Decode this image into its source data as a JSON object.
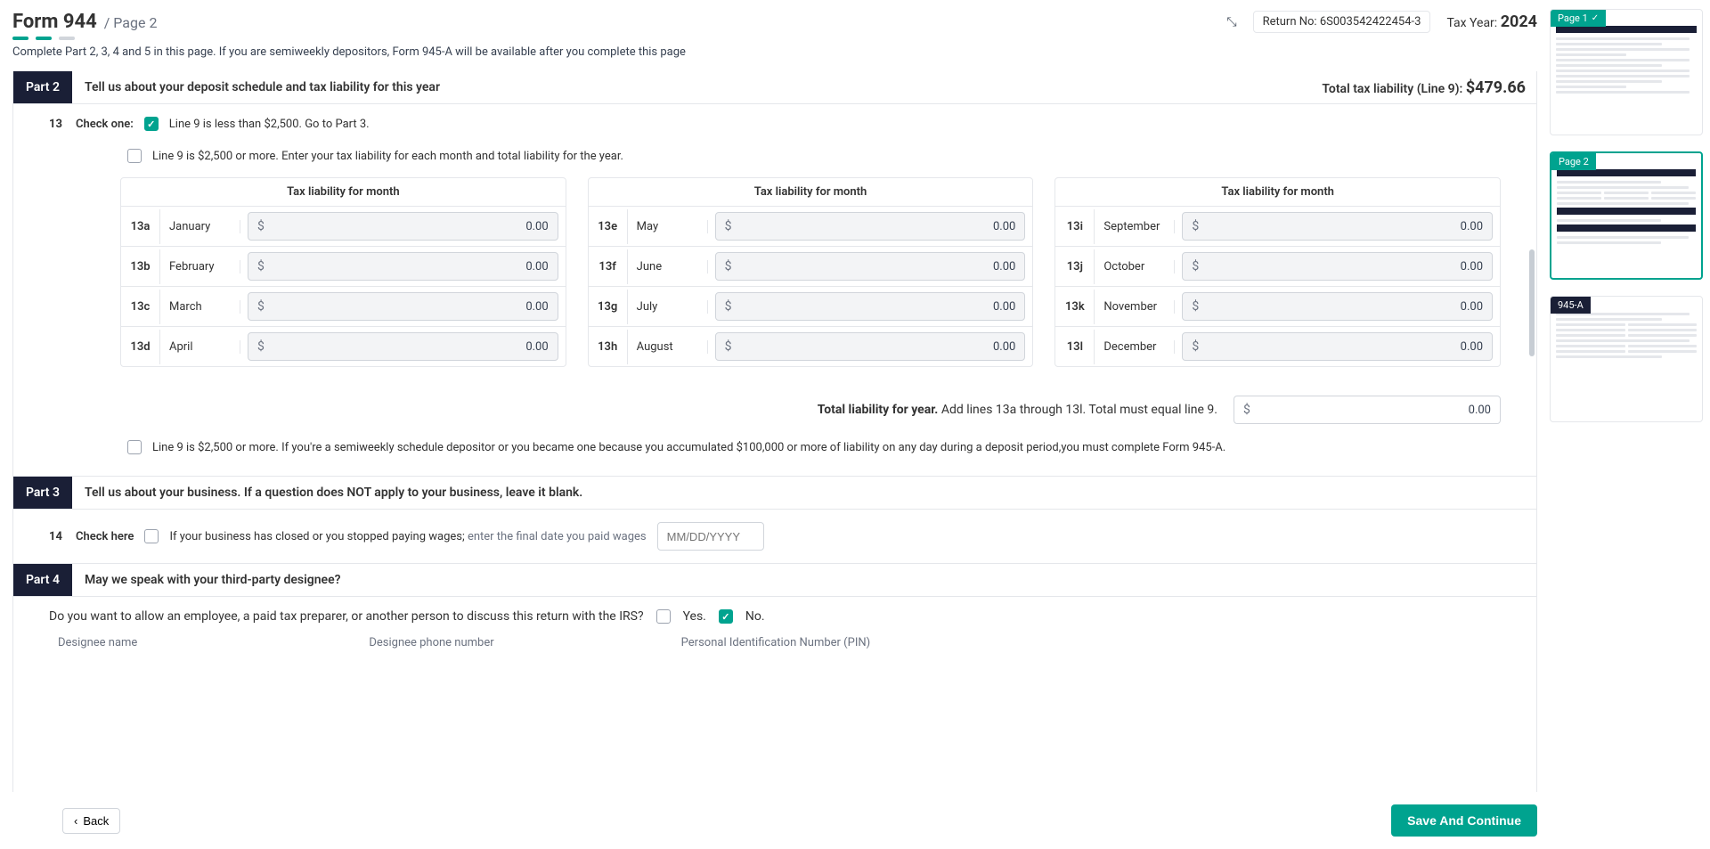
{
  "header": {
    "title": "Form 944",
    "page_label": "/ Page 2",
    "collapse_glyph": "⤡",
    "return_no_label": "Return No:",
    "return_no": "6S003542422454-3",
    "tax_year_label": "Tax Year:",
    "tax_year": "2024"
  },
  "subtitle": "Complete Part 2, 3, 4 and 5 in this page. If you are semiweekly depositors, Form 945-A will be available after you complete this page",
  "part2": {
    "tag": "Part 2",
    "desc": "Tell us about your deposit schedule and tax liability for this year",
    "total_label": "Total tax liability (Line 9):",
    "total_amount": "$479.66",
    "line13_num": "13",
    "line13_label": "Check one:",
    "opt1": "Line 9 is less than $2,500. Go to Part 3.",
    "opt2": "Line 9 is $2,500 or more. Enter your tax liability for each month and total liability for the year.",
    "opt3": "Line 9 is $2,500 or more. If you're a semiweekly schedule depositor or you became one because you accumulated $100,000 or more of liability on any day during a deposit period,you must complete Form 945-A.",
    "col_header": "Tax liability for month",
    "months": {
      "col1": [
        {
          "code": "13a",
          "name": "January",
          "value": "0.00"
        },
        {
          "code": "13b",
          "name": "February",
          "value": "0.00"
        },
        {
          "code": "13c",
          "name": "March",
          "value": "0.00"
        },
        {
          "code": "13d",
          "name": "April",
          "value": "0.00"
        }
      ],
      "col2": [
        {
          "code": "13e",
          "name": "May",
          "value": "0.00"
        },
        {
          "code": "13f",
          "name": "June",
          "value": "0.00"
        },
        {
          "code": "13g",
          "name": "July",
          "value": "0.00"
        },
        {
          "code": "13h",
          "name": "August",
          "value": "0.00"
        }
      ],
      "col3": [
        {
          "code": "13i",
          "name": "September",
          "value": "0.00"
        },
        {
          "code": "13j",
          "name": "October",
          "value": "0.00"
        },
        {
          "code": "13k",
          "name": "November",
          "value": "0.00"
        },
        {
          "code": "13l",
          "name": "December",
          "value": "0.00"
        }
      ]
    },
    "total_year_text_bold": "Total liability for year.",
    "total_year_text_rest": " Add lines 13a through 13l.  Total must equal line 9.",
    "total_year_value": "0.00"
  },
  "part3": {
    "tag": "Part 3",
    "desc": "Tell us about your business. If a question does NOT apply to your business, leave it blank.",
    "line14_num": "14",
    "line14_label": "Check here",
    "line14_text_a": "If your business has closed or you stopped paying wages;",
    "line14_text_b": " enter the final date you paid wages",
    "date_placeholder": "MM/DD/YYYY"
  },
  "part4": {
    "tag": "Part 4",
    "desc": "May we speak with your third-party designee?",
    "irs_q": "Do you want to allow an employee, a paid tax preparer, or another person to discuss this return with the IRS?",
    "yes": "Yes.",
    "no": "No.",
    "des_name": "Designee name",
    "des_phone": "Designee phone number",
    "des_pin": "Personal Identification Number (PIN)"
  },
  "footer": {
    "back": "Back",
    "save": "Save And Continue"
  },
  "sidebar": {
    "p1": "Page 1",
    "p2": "Page 2",
    "p3": "945-A"
  },
  "glyphs": {
    "dollar": "$",
    "chevron_left": "‹"
  }
}
